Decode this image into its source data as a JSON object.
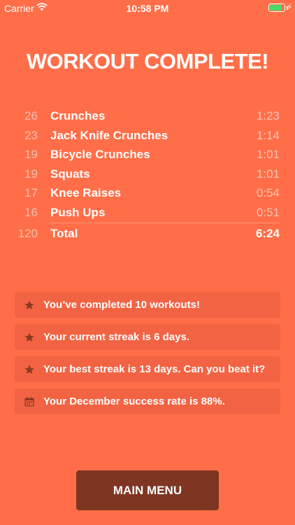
{
  "status": {
    "carrier": "Carrier",
    "time": "10:58 PM",
    "battery_level": 0.85,
    "battery_color": "#4CD964"
  },
  "title": "WORKOUT COMPLETE!",
  "exercises": [
    {
      "count": "26",
      "name": "Crunches",
      "time": "1:23"
    },
    {
      "count": "23",
      "name": "Jack Knife Crunches",
      "time": "1:14"
    },
    {
      "count": "19",
      "name": "Bicycle Crunches",
      "time": "1:01"
    },
    {
      "count": "19",
      "name": "Squats",
      "time": "1:01"
    },
    {
      "count": "17",
      "name": "Knee Raises",
      "time": "0:54"
    },
    {
      "count": "16",
      "name": "Push Ups",
      "time": "0:51"
    }
  ],
  "total": {
    "count": "120",
    "label": "Total",
    "time": "6:24"
  },
  "stats": [
    {
      "icon": "star-icon",
      "text": "You’ve completed 10 workouts!"
    },
    {
      "icon": "star-icon",
      "text": "Your current streak is 6 days."
    },
    {
      "icon": "star-icon",
      "text": "Your best streak is 13 days. Can you beat it?"
    },
    {
      "icon": "calendar-icon",
      "text": "Your December success rate is 88%."
    }
  ],
  "main_menu_label": "MAIN MENU",
  "colors": {
    "background": "#FF6E48",
    "card": "#F26343",
    "icon": "#8B3A26",
    "button": "#7E3623"
  }
}
